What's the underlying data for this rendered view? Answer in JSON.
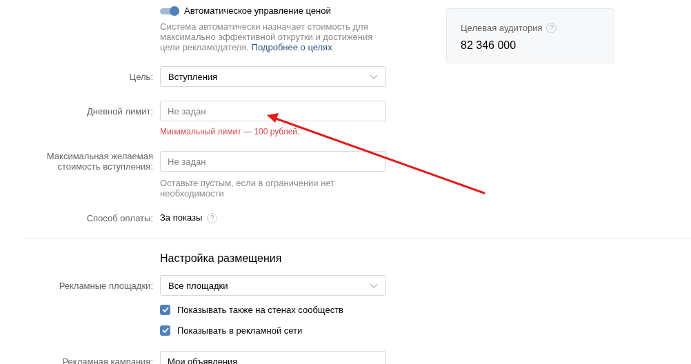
{
  "auto_price": {
    "label": "Автоматическое управление ценой",
    "on": true,
    "description": "Система автоматически назначает стоимость для максимально эффективной открутки и достижения цели рекламодателя.",
    "link": "Подробнее о целях"
  },
  "fields": [
    {
      "kind": "select",
      "label": "Цель:",
      "value": "Вступления"
    },
    {
      "kind": "input",
      "label": "Дневной лимит:",
      "placeholder": "Не задан",
      "error": "Минимальный лимит — 100 рублей."
    },
    {
      "kind": "input",
      "label": "Максимальная желаемая стоимость вступления:",
      "placeholder": "Не задан",
      "hint": "Оставьте пустым, если в ограничении нет необходимости"
    },
    {
      "kind": "text",
      "label": "Способ оплаты:",
      "value": "За показы",
      "help": "?"
    }
  ],
  "audience": {
    "title": "Целевая аудитория",
    "help": "?",
    "value": "82 346 000"
  },
  "placement": {
    "title": "Настройка размещения",
    "fields": [
      {
        "kind": "select",
        "label": "Рекламные площадки:",
        "value": "Все площадки"
      },
      {
        "kind": "checkbox",
        "label": "Показывать также на стенах сообществ",
        "checked": true
      },
      {
        "kind": "checkbox",
        "label": "Показывать в рекламной сети",
        "checked": true
      },
      {
        "kind": "input",
        "label": "Рекламная кампания:",
        "value": "Мои объявления"
      }
    ]
  }
}
